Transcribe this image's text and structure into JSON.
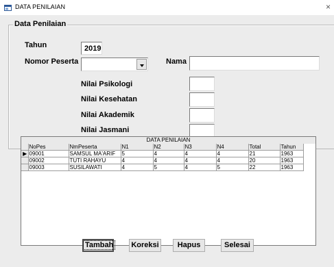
{
  "window": {
    "title": "DATA PENILAIAN",
    "close_glyph": "×"
  },
  "form": {
    "group_title": "Data Penilaian",
    "tahun_label": "Tahun",
    "tahun_value": "2019",
    "nomor_label": "Nomor Peserta",
    "nomor_value": "",
    "nama_label": "Nama",
    "nama_value": "",
    "psikologi_label": "Nilai Psikologi",
    "psikologi_value": "",
    "kesehatan_label": "Nilai Kesehatan",
    "kesehatan_value": "",
    "akademik_label": "Nilai Akademik",
    "akademik_value": "",
    "jasmani_label": "Nilai Jasmani",
    "jasmani_value": ""
  },
  "grid": {
    "caption": "DATA PENILAIAN",
    "selected_marker": "▶",
    "columns": [
      "NoPes",
      "NmPeserta",
      "N1",
      "N2",
      "N3",
      "N4",
      "Total",
      "Tahun"
    ],
    "rows": [
      [
        "09001",
        "SAMSUL MA'ARIF",
        "5",
        "4",
        "4",
        "4",
        "21",
        "1963"
      ],
      [
        "09002",
        "TUTI RAHAYU",
        "4",
        "4",
        "4",
        "4",
        "20",
        "1963"
      ],
      [
        "09003",
        "SUSILAWATI",
        "4",
        "5",
        "4",
        "5",
        "22",
        "1963"
      ]
    ]
  },
  "buttons": {
    "tambah": "Tambah",
    "koreksi": "Koreksi",
    "hapus": "Hapus",
    "selesai": "Selesai"
  },
  "colors": {
    "window_bg": "#ececec",
    "grid_header_bg": "#e9e9e9"
  }
}
